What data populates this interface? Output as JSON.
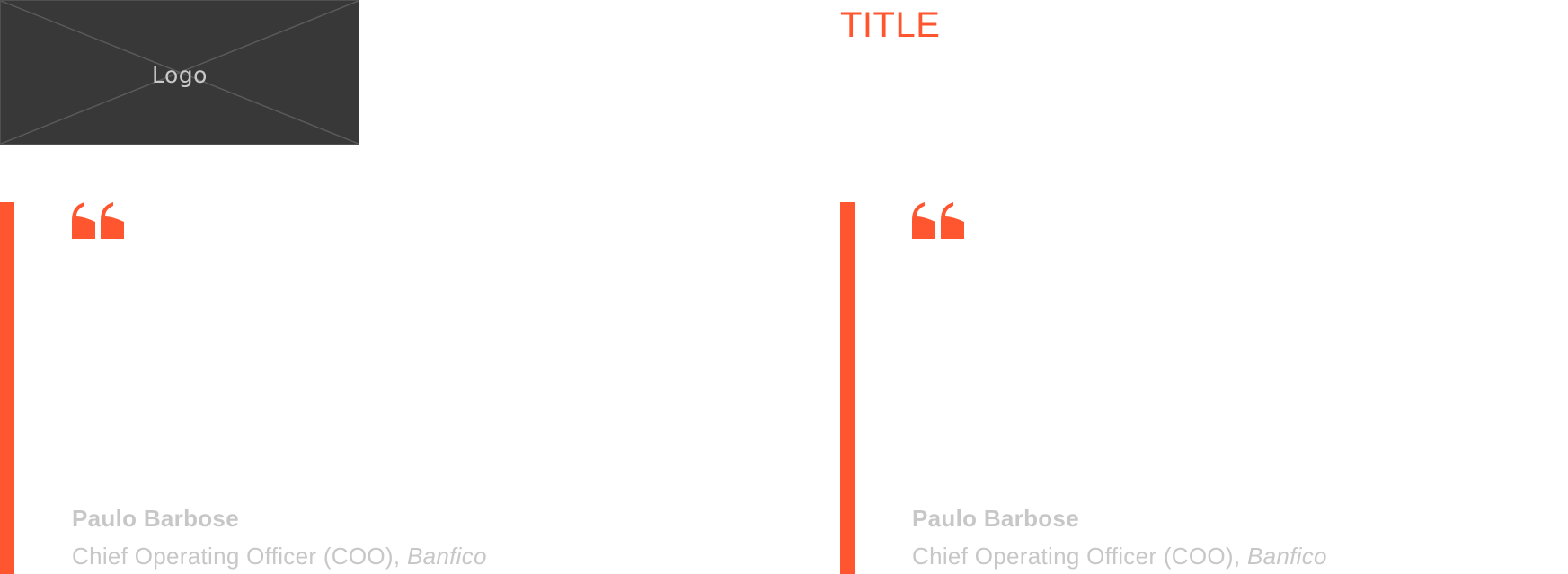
{
  "logo": {
    "label": "Logo",
    "background_color": "#383838"
  },
  "header": {
    "title": "TITLE",
    "accent_color": "#ff5630"
  },
  "testimonials": [
    {
      "quote_icon": "quote-open-icon",
      "author_name": "Paulo Barbose",
      "author_role": "Chief Operating Officer (COO), ",
      "author_company": "Banfico"
    },
    {
      "quote_icon": "quote-open-icon",
      "author_name": "Paulo Barbose",
      "author_role": "Chief Operating Officer (COO), ",
      "author_company": "Banfico"
    }
  ]
}
